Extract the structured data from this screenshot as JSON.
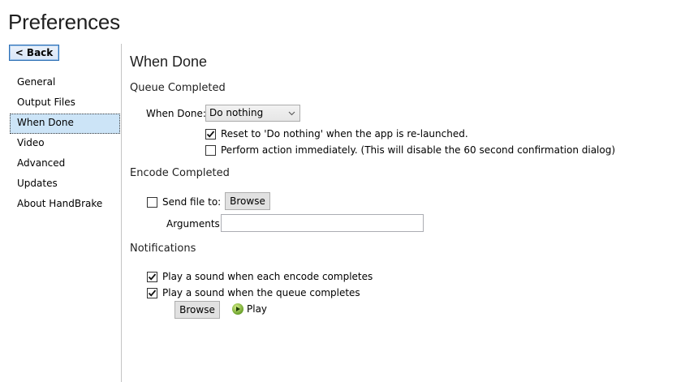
{
  "window": {
    "title": "Preferences"
  },
  "sidebar": {
    "back_label": "< Back",
    "items": [
      {
        "label": "General",
        "selected": false
      },
      {
        "label": "Output Files",
        "selected": false
      },
      {
        "label": "When Done",
        "selected": true
      },
      {
        "label": "Video",
        "selected": false
      },
      {
        "label": "Advanced",
        "selected": false
      },
      {
        "label": "Updates",
        "selected": false
      },
      {
        "label": "About HandBrake",
        "selected": false
      }
    ]
  },
  "main": {
    "heading": "When Done",
    "queue": {
      "section_title": "Queue Completed",
      "when_done_label": "When Done:",
      "when_done_value": "Do nothing",
      "reset_label": "Reset to 'Do nothing' when the app is re-launched.",
      "reset_checked": true,
      "immediate_label": "Perform action immediately. (This will disable the 60 second confirmation dialog)",
      "immediate_checked": false
    },
    "encode": {
      "section_title": "Encode Completed",
      "send_file_label": "Send file to:",
      "send_file_checked": false,
      "browse_label": "Browse",
      "arguments_label": "Arguments:",
      "arguments_value": ""
    },
    "notifications": {
      "section_title": "Notifications",
      "encode_sound_label": "Play a sound when each encode completes",
      "encode_sound_checked": true,
      "queue_sound_label": "Play a sound when the queue completes",
      "queue_sound_checked": true,
      "browse_label": "Browse",
      "play_label": "Play"
    }
  },
  "icons": {
    "play": "play-icon",
    "dropdown": "chevron-down-icon",
    "check": "checkmark"
  },
  "colors": {
    "selection": "#cce4f7",
    "accent": "#2c6fb5",
    "play_green": "#6aa12a"
  }
}
